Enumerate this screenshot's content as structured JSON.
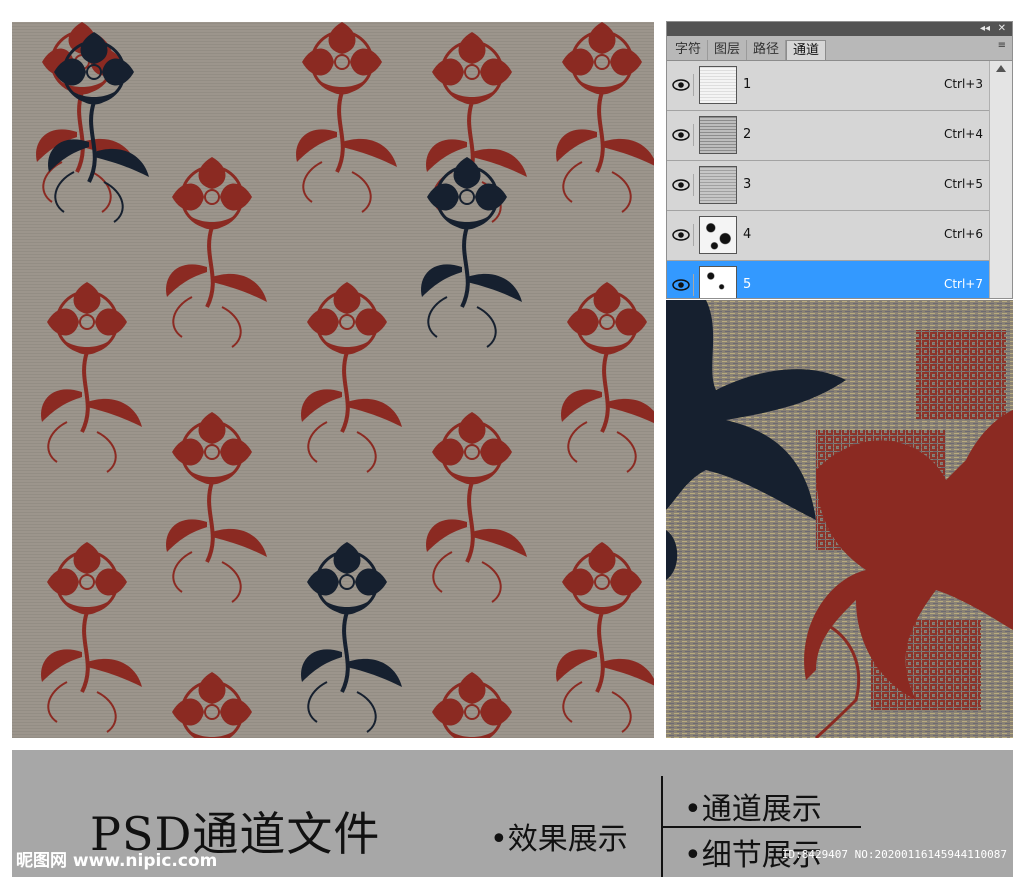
{
  "panel": {
    "topbar_controls": [
      "◂◂",
      "✕"
    ],
    "tabs": [
      {
        "label": "字符",
        "active": false
      },
      {
        "label": "图层",
        "active": false
      },
      {
        "label": "路径",
        "active": false
      },
      {
        "label": "通道",
        "active": true
      }
    ],
    "menu_icon": "≡",
    "channels": [
      {
        "name": "1",
        "shortcut": "Ctrl+3",
        "visible": true,
        "selected": false
      },
      {
        "name": "2",
        "shortcut": "Ctrl+4",
        "visible": true,
        "selected": false
      },
      {
        "name": "3",
        "shortcut": "Ctrl+5",
        "visible": true,
        "selected": false
      },
      {
        "name": "4",
        "shortcut": "Ctrl+6",
        "visible": true,
        "selected": false
      },
      {
        "name": "5",
        "shortcut": "Ctrl+7",
        "visible": true,
        "selected": true
      }
    ]
  },
  "caption": {
    "title": "PSD通道文件",
    "effect": "•效果展示",
    "channel_show": "•通道展示",
    "detail_show": "•细节展示",
    "watermark_left": "昵图网 www.nipic.com",
    "watermark_right": "ID:8429407 NO:20200116145944110087"
  },
  "colors": {
    "fabric": "#9b948b",
    "red_motif": "#8b2a22",
    "navy_motif": "#16202f",
    "selection": "#3399ff"
  }
}
